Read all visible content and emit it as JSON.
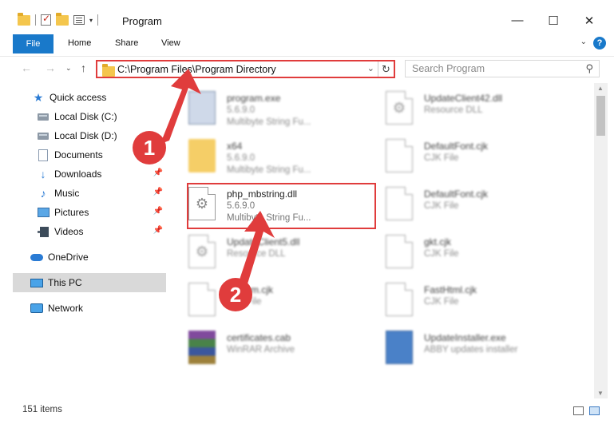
{
  "window": {
    "title": "Program",
    "min_icon": "minimize-icon",
    "max_icon": "maximize-icon",
    "close_icon": "close-icon"
  },
  "ribbon": {
    "tabs": [
      "File",
      "Home",
      "Share",
      "View"
    ]
  },
  "address": {
    "path": "C:\\Program Files\\Program Directory"
  },
  "search": {
    "placeholder": "Search Program"
  },
  "sidebar": {
    "items": [
      {
        "label": "Quick access"
      },
      {
        "label": "Local Disk (C:)"
      },
      {
        "label": "Local Disk (D:)"
      },
      {
        "label": "Documents"
      },
      {
        "label": "Downloads"
      },
      {
        "label": "Music"
      },
      {
        "label": "Pictures"
      },
      {
        "label": "Videos"
      },
      {
        "label": "OneDrive"
      },
      {
        "label": "This PC"
      },
      {
        "label": "Network"
      }
    ]
  },
  "files": [
    {
      "name": "program.exe",
      "line2": "5.6.9.0",
      "line3": "Multibyte String Fu..."
    },
    {
      "name": "UpdateClient42.dll",
      "line2": "Resource DLL",
      "line3": ""
    },
    {
      "name": "x64",
      "line2": "5.6.9.0",
      "line3": "Multibyte String Fu..."
    },
    {
      "name": "DefaultFont.cjk",
      "line2": "CJK File",
      "line3": ""
    },
    {
      "name": "php_mbstring.dll",
      "line2": "5.6.9.0",
      "line3": "Multibyte String Fu..."
    },
    {
      "name": "DefaultFont.cjk",
      "line2": "CJK File",
      "line3": ""
    },
    {
      "name": "UpdateClient5.dll",
      "line2": "Resource DLL",
      "line3": ""
    },
    {
      "name": "gkt.cjk",
      "line2": "CJK File",
      "line3": ""
    },
    {
      "name": "System.cjk",
      "line2": "CJK File",
      "line3": ""
    },
    {
      "name": "FastHtml.cjk",
      "line2": "CJK File",
      "line3": ""
    },
    {
      "name": "certificates.cab",
      "line2": "WinRAR Archive",
      "line3": ""
    },
    {
      "name": "UpdateInstaller.exe",
      "line2": "ABBY updates installer",
      "line3": ""
    }
  ],
  "status": {
    "count": "151 items"
  },
  "annotations": {
    "step1": "1",
    "step2": "2",
    "color": "#e03c3c"
  }
}
